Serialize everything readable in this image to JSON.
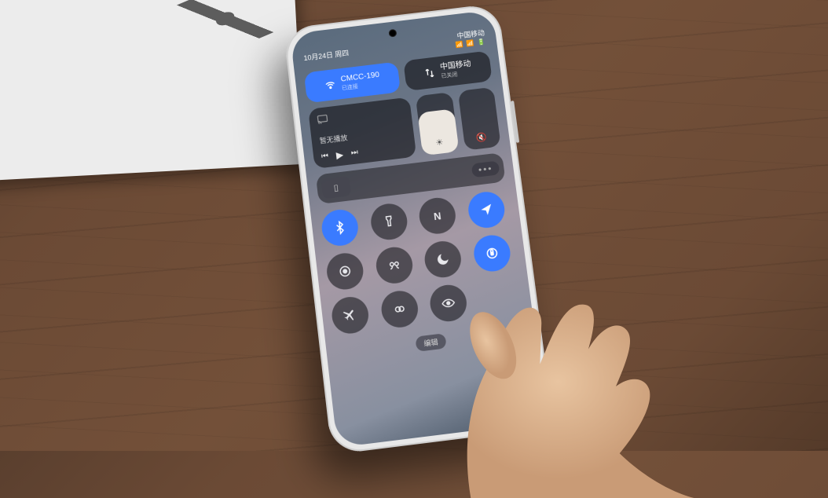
{
  "statusbar": {
    "date": "10月24日 周四",
    "carrier": "中国移动"
  },
  "wifi": {
    "ssid": "CMCC-190",
    "status": "已连接"
  },
  "cellular": {
    "name": "中国移动",
    "status": "已关闭"
  },
  "media": {
    "label": "暂无播放"
  },
  "brightness": {
    "level_percent": 72
  },
  "volume": {
    "level_percent": 0
  },
  "toggles": {
    "bluetooth": {
      "active": true
    },
    "flashlight": {
      "active": false
    },
    "nfc": {
      "label": "N",
      "active": false
    },
    "location": {
      "active": true
    },
    "eyecare": {
      "active": false
    },
    "screenshot": {
      "active": false
    },
    "dnd": {
      "active": false
    },
    "rotation_lock": {
      "active": true
    },
    "airplane": {
      "active": false
    },
    "hotspot": {
      "active": false
    },
    "visibility": {
      "active": false
    }
  },
  "edit_label": "编辑"
}
